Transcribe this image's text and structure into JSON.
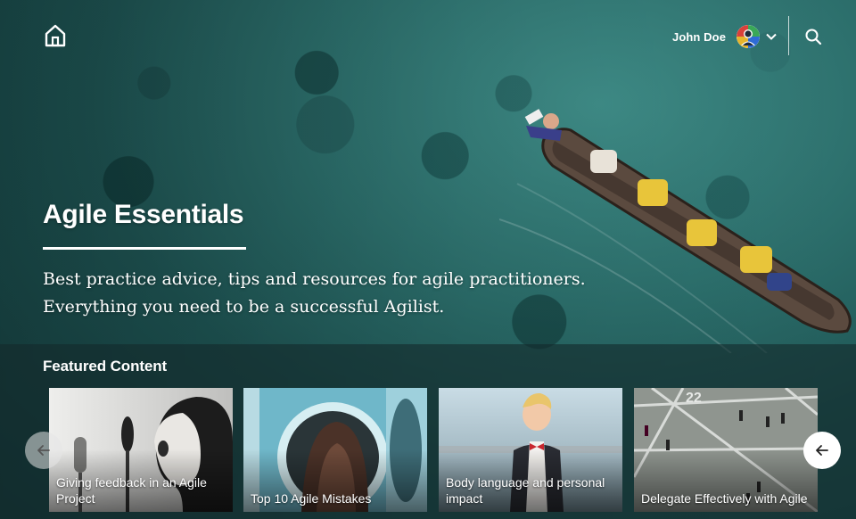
{
  "header": {
    "home_icon": "home-icon",
    "user_name": "John Doe",
    "avatar_icon": "avatar-icon",
    "menu_icon": "chevron-down-icon",
    "search_icon": "search-icon"
  },
  "hero": {
    "title": "Agile Essentials",
    "description_line1": "Best practice advice, tips and resources for agile practitioners.",
    "description_line2": "Everything you need to be a successful Agilist."
  },
  "featured": {
    "heading": "Featured Content",
    "prev_icon": "arrow-left-icon",
    "next_icon": "arrow-left-icon",
    "cards": [
      {
        "title": "Giving feedback in an Agile Project"
      },
      {
        "title": "Top 10 Agile Mistakes"
      },
      {
        "title": "Body language and personal impact"
      },
      {
        "title": "Delegate Effectively with Agile",
        "image_text": "22"
      }
    ]
  }
}
